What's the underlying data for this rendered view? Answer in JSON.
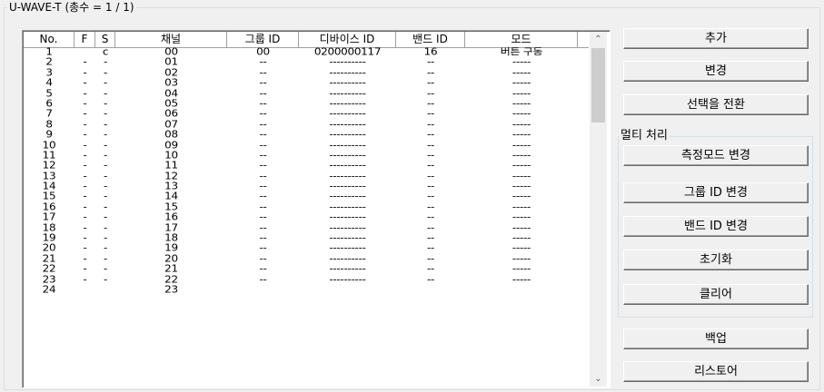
{
  "group_title": "U-WAVE-T (총수 = 1 / 1)",
  "table": {
    "columns": [
      "No.",
      "F",
      "S",
      "채널",
      "그룹 ID",
      "디바이스 ID",
      "밴드 ID",
      "모드"
    ],
    "rows": [
      [
        "1",
        "",
        "c",
        "00",
        "00",
        "0200000117",
        "16",
        "버튼 구동"
      ],
      [
        "2",
        "-",
        "-",
        "01",
        "--",
        "----------",
        "--",
        "-----"
      ],
      [
        "3",
        "-",
        "-",
        "02",
        "--",
        "----------",
        "--",
        "-----"
      ],
      [
        "4",
        "-",
        "-",
        "03",
        "--",
        "----------",
        "--",
        "-----"
      ],
      [
        "5",
        "-",
        "-",
        "04",
        "--",
        "----------",
        "--",
        "-----"
      ],
      [
        "6",
        "-",
        "-",
        "05",
        "--",
        "----------",
        "--",
        "-----"
      ],
      [
        "7",
        "-",
        "-",
        "06",
        "--",
        "----------",
        "--",
        "-----"
      ],
      [
        "8",
        "-",
        "-",
        "07",
        "--",
        "----------",
        "--",
        "-----"
      ],
      [
        "9",
        "-",
        "-",
        "08",
        "--",
        "----------",
        "--",
        "-----"
      ],
      [
        "10",
        "-",
        "-",
        "09",
        "--",
        "----------",
        "--",
        "-----"
      ],
      [
        "11",
        "-",
        "-",
        "10",
        "--",
        "----------",
        "--",
        "-----"
      ],
      [
        "12",
        "-",
        "-",
        "11",
        "--",
        "----------",
        "--",
        "-----"
      ],
      [
        "13",
        "-",
        "-",
        "12",
        "--",
        "----------",
        "--",
        "-----"
      ],
      [
        "14",
        "-",
        "-",
        "13",
        "--",
        "----------",
        "--",
        "-----"
      ],
      [
        "15",
        "-",
        "-",
        "14",
        "--",
        "----------",
        "--",
        "-----"
      ],
      [
        "16",
        "-",
        "-",
        "15",
        "--",
        "----------",
        "--",
        "-----"
      ],
      [
        "17",
        "-",
        "-",
        "16",
        "--",
        "----------",
        "--",
        "-----"
      ],
      [
        "18",
        "-",
        "-",
        "17",
        "--",
        "----------",
        "--",
        "-----"
      ],
      [
        "19",
        "-",
        "-",
        "18",
        "--",
        "----------",
        "--",
        "-----"
      ],
      [
        "20",
        "-",
        "-",
        "19",
        "--",
        "----------",
        "--",
        "-----"
      ],
      [
        "21",
        "-",
        "-",
        "20",
        "--",
        "----------",
        "--",
        "-----"
      ],
      [
        "22",
        "-",
        "-",
        "21",
        "--",
        "----------",
        "--",
        "-----"
      ],
      [
        "23",
        "-",
        "-",
        "22",
        "--",
        "----------",
        "--",
        "-----"
      ],
      [
        "24",
        "",
        "",
        "23",
        "",
        "",
        "",
        ""
      ]
    ]
  },
  "buttons": {
    "add": "추가",
    "change": "변경",
    "toggle_selection": "선택을 전환",
    "backup": "백업",
    "restore": "리스토어"
  },
  "multi": {
    "title": "멀티 처리",
    "change_mode": "측정모드 변경",
    "change_group_id": "그룹 ID 변경",
    "change_band_id": "밴드 ID 변경",
    "initialize": "초기화",
    "clear": "클리어"
  },
  "scrollbar": {
    "up_icon": "chevron-up-icon",
    "down_icon": "chevron-down-icon"
  }
}
